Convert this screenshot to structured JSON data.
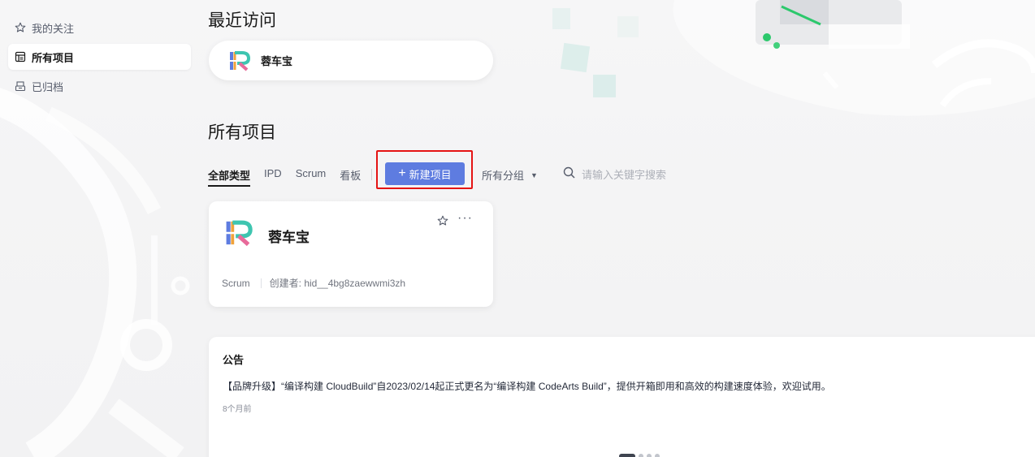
{
  "sidebar": {
    "items": [
      {
        "label": "我的关注",
        "icon": "star-outline-icon",
        "active": false
      },
      {
        "label": "所有项目",
        "icon": "project-list-icon",
        "active": true
      },
      {
        "label": "已归档",
        "icon": "archive-box-icon",
        "active": false
      }
    ]
  },
  "recent": {
    "title": "最近访问",
    "items": [
      {
        "name": "蓉车宝",
        "logo": "project-logo-icon"
      }
    ]
  },
  "projects": {
    "title": "所有项目",
    "tabs": [
      "全部类型",
      "IPD",
      "Scrum",
      "看板"
    ],
    "active_tab": "全部类型",
    "new_button": {
      "plus": "+",
      "label": "新建项目"
    },
    "group_select": {
      "value": "所有分组",
      "caret": "▼"
    },
    "search": {
      "placeholder": "请输入关键字搜索"
    },
    "cards": [
      {
        "name": "蓉车宝",
        "type": "Scrum",
        "creator": "创建者: hid__4bg8zaewwmi3zh",
        "more": "···"
      }
    ]
  },
  "notice": {
    "title": "公告",
    "content": "【品牌升级】“编译构建 CloudBuild”自2023/02/14起正式更名为“编译构建 CodeArts Build”，提供开箱即用和高效的构建速度体验，欢迎试用。",
    "time": "8个月前"
  },
  "colors": {
    "primary": "#5e7ce0",
    "highlight": "#e51414",
    "accent_green": "#2cc86c"
  }
}
